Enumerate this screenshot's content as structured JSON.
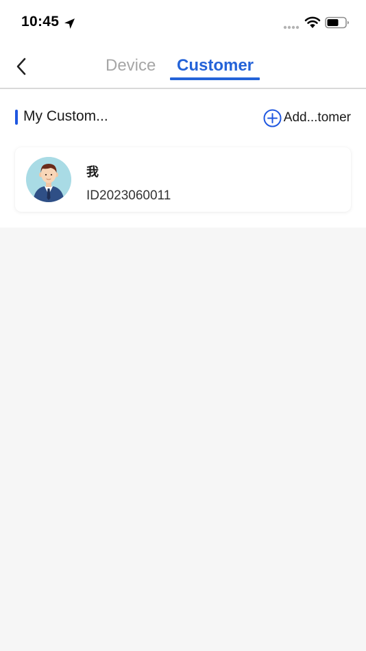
{
  "status_bar": {
    "time": "10:45",
    "icons": [
      "location-arrow-icon",
      "signal-dots-icon",
      "wifi-icon",
      "battery-icon"
    ]
  },
  "nav": {
    "back_icon": "chevron-left-icon",
    "tabs": [
      {
        "label": "Device",
        "active": false
      },
      {
        "label": "Customer",
        "active": true
      }
    ]
  },
  "section": {
    "title": "My Custom...",
    "add_label": "Add...tomer",
    "add_icon": "plus-circle-icon"
  },
  "customers": [
    {
      "name": "我",
      "id": "ID2023060011",
      "avatar_icon": "user-avatar-icon"
    }
  ],
  "colors": {
    "accent": "#2463d8",
    "section_bar": "#1f57e0",
    "inactive_tab": "#a6a6a6",
    "background": "#f6f6f6",
    "card": "#ffffff"
  }
}
